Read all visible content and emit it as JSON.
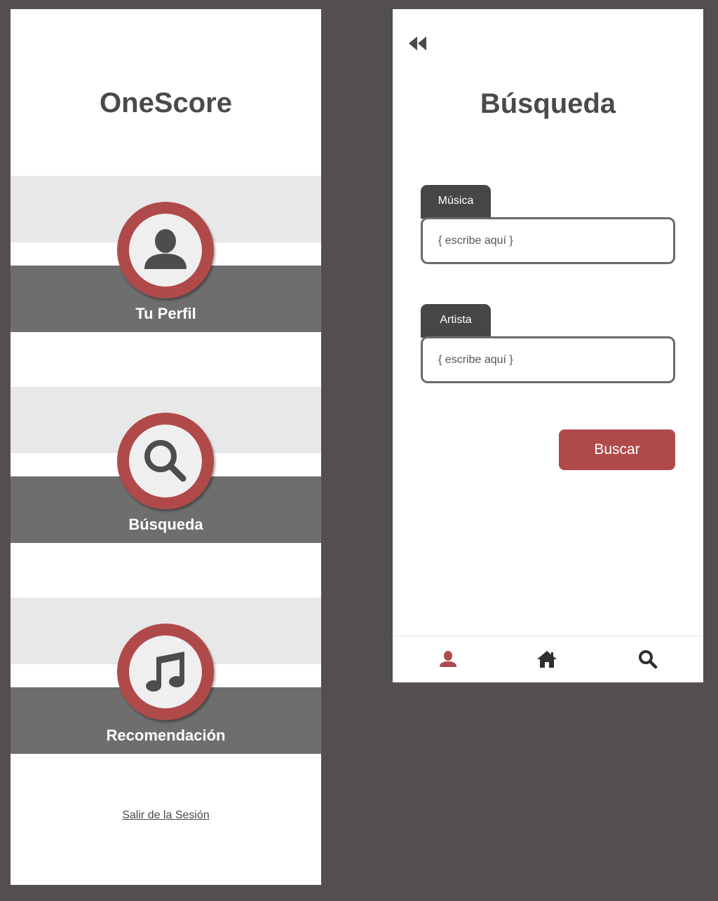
{
  "menu_screen": {
    "app_title": "OneScore",
    "cards": [
      {
        "label": "Tu Perfil",
        "icon": "user-icon"
      },
      {
        "label": "Búsqueda",
        "icon": "search-icon"
      },
      {
        "label": "Recomendación",
        "icon": "music-note-icon"
      }
    ],
    "logout_label": "Salir de la Sesión"
  },
  "search_screen": {
    "back_icon": "double-chevron-left-icon",
    "title": "Búsqueda",
    "fields": [
      {
        "label": "Música",
        "placeholder": "{ escribe aquí }"
      },
      {
        "label": "Artista",
        "placeholder": "{ escribe aquí }"
      }
    ],
    "search_button_label": "Buscar",
    "bottom_nav": [
      {
        "icon": "user-icon",
        "active": true
      },
      {
        "icon": "home-icon",
        "active": false
      },
      {
        "icon": "search-icon",
        "active": false
      }
    ]
  },
  "colors": {
    "background": "#524f4e",
    "accent": "#b04a4a",
    "dark_band": "#6e6e6e",
    "light_band": "#e8e8e8",
    "text_dark": "#4a4a4a"
  }
}
